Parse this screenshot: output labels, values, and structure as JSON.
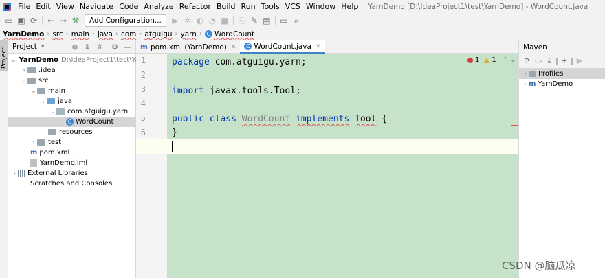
{
  "menubar": {
    "items": [
      "File",
      "Edit",
      "View",
      "Navigate",
      "Code",
      "Analyze",
      "Refactor",
      "Build",
      "Run",
      "Tools",
      "VCS",
      "Window",
      "Help"
    ],
    "window_title": "YarnDemo [D:\\IdeaProject1\\test\\YarnDemo] - WordCount.java"
  },
  "toolbar": {
    "add_configuration_label": "Add Configuration..."
  },
  "breadcrumb": [
    "YarnDemo",
    "src",
    "main",
    "java",
    "com",
    "atguigu",
    "yarn",
    "WordCount"
  ],
  "left_strip": {
    "project_label": "Project"
  },
  "project_panel": {
    "title": "Project",
    "tree": [
      {
        "label": "YarnDemo",
        "extra": "D:\\IdeaProject1\\test\\Ya"
      },
      {
        "label": ".idea"
      },
      {
        "label": "src"
      },
      {
        "label": "main"
      },
      {
        "label": "java"
      },
      {
        "label": "com.atguigu.yarn"
      },
      {
        "label": "WordCount"
      },
      {
        "label": "resources"
      },
      {
        "label": "test"
      },
      {
        "label": "pom.xml"
      },
      {
        "label": "YarnDemo.iml"
      },
      {
        "label": "External Libraries"
      },
      {
        "label": "Scratches and Consoles"
      }
    ]
  },
  "editor": {
    "tabs": [
      {
        "label": "pom.xml (YarnDemo)",
        "active": false
      },
      {
        "label": "WordCount.java",
        "active": true
      }
    ],
    "line_numbers": [
      "1",
      "2",
      "3",
      "4",
      "5",
      "6",
      "7"
    ],
    "code": {
      "l1_kw": "package",
      "l1_rest": " com.atguigu.yarn;",
      "l3_kw": "import",
      "l3_rest": " javax.tools.Tool;",
      "l5_kw1": "public class",
      "l5_cls": "WordCount",
      "l5_kw2": "implements",
      "l5_type": "Tool",
      "l5_brace": " {",
      "l6": "}"
    },
    "inspection": {
      "errors": "1",
      "warnings": "1"
    }
  },
  "maven": {
    "title": "Maven",
    "items": [
      "Profiles",
      "YarnDemo"
    ]
  },
  "watermark": "CSDN @脑瓜凉"
}
